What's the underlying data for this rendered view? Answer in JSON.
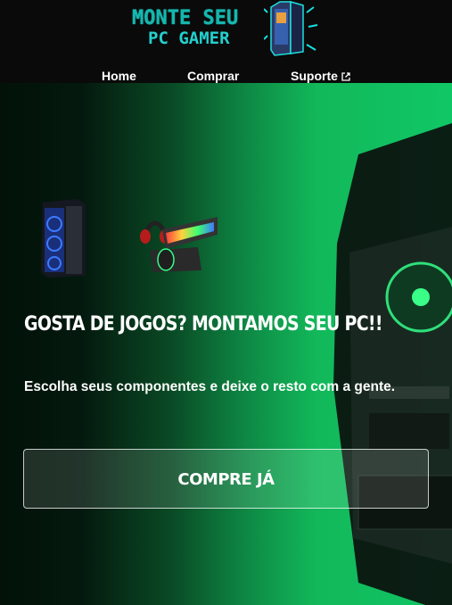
{
  "logo": {
    "line1": "MONTE SEU",
    "line2": "PC GAMER",
    "icon": "gamer-pc-logo-icon"
  },
  "nav": {
    "items": [
      {
        "label": "Home"
      },
      {
        "label": "Comprar"
      },
      {
        "label": "Suporte"
      }
    ],
    "external_icon": "external-link-icon"
  },
  "hero": {
    "headline": "GOSTA DE JOGOS? MONTAMOS SEU PC!!",
    "subtext": "Escolha seus componentes e deixe o resto com a gente.",
    "cta_label": "COMPRE JÁ",
    "images": [
      "gaming-tower-image",
      "keyboard-headset-mouse-image"
    ],
    "background_image": "pc-case-side-panel-image"
  },
  "colors": {
    "accent_green": "#12c763",
    "logo_cyan": "#1fc7c2",
    "header_bg": "#0a0a0a"
  }
}
